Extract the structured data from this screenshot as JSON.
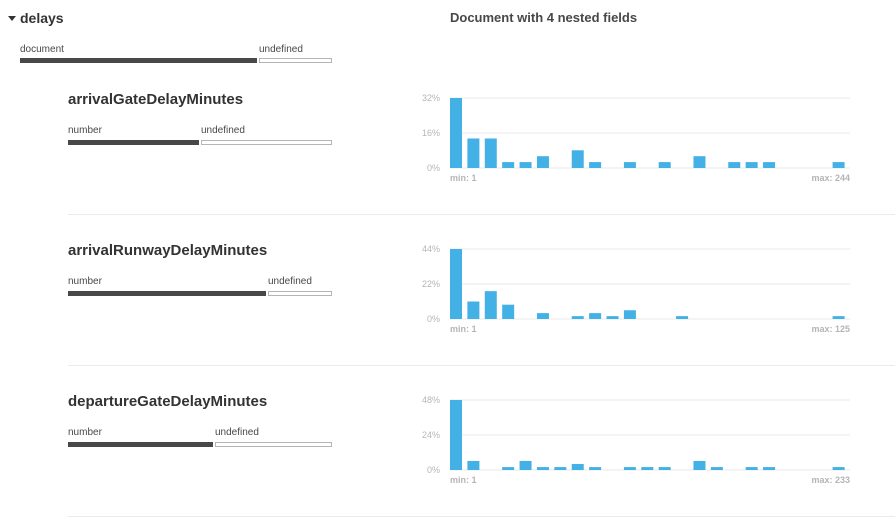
{
  "parent": {
    "name": "delays",
    "summary": "Document with 4 nested fields",
    "types": [
      {
        "label": "document",
        "fraction": 0.785
      },
      {
        "label": "undefined",
        "fraction": 0.215
      }
    ]
  },
  "fields": [
    {
      "name": "arrivalGateDelayMinutes",
      "types": [
        {
          "label": "number",
          "fraction": 0.5
        },
        {
          "label": "undefined",
          "fraction": 0.5
        }
      ]
    },
    {
      "name": "arrivalRunwayDelayMinutes",
      "types": [
        {
          "label": "number",
          "fraction": 0.75
        },
        {
          "label": "undefined",
          "fraction": 0.25
        }
      ]
    },
    {
      "name": "departureGateDelayMinutes",
      "types": [
        {
          "label": "number",
          "fraction": 0.55
        },
        {
          "label": "undefined",
          "fraction": 0.45
        }
      ]
    }
  ],
  "colors": {
    "bar": "#43b1e5",
    "type_dark": "#494747",
    "grid": "#eaeaea",
    "label": "#b5b5b5"
  },
  "chart_data": [
    {
      "type": "bar",
      "field": "arrivalGateDelayMinutes",
      "y_ticks": [
        "32%",
        "16%",
        "0%"
      ],
      "ylim": [
        0,
        32
      ],
      "min_label": "min: 1",
      "max_label": "max: 244",
      "values": [
        32,
        13.5,
        13.5,
        2.7,
        2.7,
        5.4,
        0,
        8.1,
        2.7,
        0,
        2.7,
        0,
        2.7,
        0,
        5.4,
        0,
        2.7,
        2.7,
        2.7,
        0,
        0,
        0,
        2.7
      ]
    },
    {
      "type": "bar",
      "field": "arrivalRunwayDelayMinutes",
      "y_ticks": [
        "44%",
        "22%",
        "0%"
      ],
      "ylim": [
        0,
        44
      ],
      "min_label": "min: 1",
      "max_label": "max: 125",
      "values": [
        44,
        11,
        17.5,
        9,
        0,
        3.7,
        0,
        1.8,
        3.7,
        1.8,
        5.5,
        0,
        0,
        1.8,
        0,
        0,
        0,
        0,
        0,
        0,
        0,
        0,
        1.8
      ]
    },
    {
      "type": "bar",
      "field": "departureGateDelayMinutes",
      "y_ticks": [
        "48%",
        "24%",
        "0%"
      ],
      "ylim": [
        0,
        48
      ],
      "min_label": "min: 1",
      "max_label": "max: 233",
      "values": [
        48,
        6.2,
        0,
        2,
        6.2,
        2,
        2,
        4.1,
        2,
        0,
        2,
        2,
        2,
        0,
        6.2,
        2,
        0,
        2,
        2,
        0,
        0,
        0,
        2
      ]
    }
  ]
}
